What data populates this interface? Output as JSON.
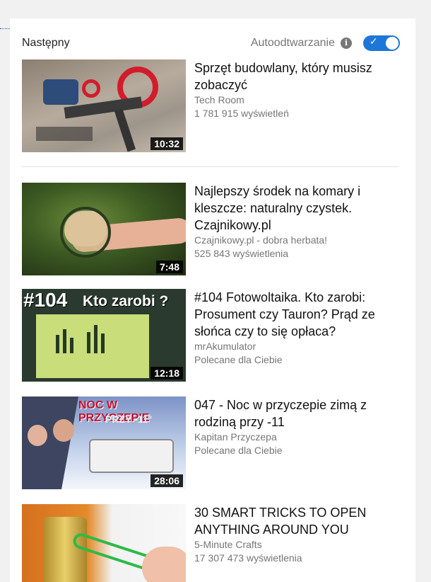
{
  "header": {
    "up_next": "Następny",
    "autoplay_label": "Autoodtwarzanie",
    "autoplay_info_icon": "info-icon",
    "autoplay_on": true
  },
  "colors": {
    "accent": "#1e77d8",
    "text_primary": "#111111",
    "text_secondary": "#767676"
  },
  "videos": [
    {
      "title": "Sprzęt budowlany, który musisz zobaczyć",
      "channel": "Tech Room",
      "stat": "1 781 915 wyświetleń",
      "duration": "10:32"
    },
    {
      "title": "Najlepszy środek na komary i kleszcze: naturalny czystek. Czajnikowy.pl",
      "channel": "Czajnikowy.pl - dobra herbata!",
      "stat": "525 843 wyświetlenia",
      "duration": "7:48"
    },
    {
      "title": "#104 Fotowoltaika. Kto zarobi: Prosument czy Tauron? Prąd ze słońca czy to się opłaca?",
      "channel": "mrAkumulator",
      "stat": "Polecane dla Ciebie",
      "duration": "12:18",
      "thumb_text": "#104",
      "thumb_text2": "Kto zarobi ?"
    },
    {
      "title": "047 - Noc w przyczepie zimą z rodziną przy -11",
      "channel": "Kapitan Przyczepa",
      "stat": "Polecane dla Ciebie",
      "duration": "28:06",
      "thumb_text": "NOC W PRZYCZEPIE",
      "thumb_text2": "PRZY -11°"
    },
    {
      "title": "30 SMART TRICKS TO OPEN ANYTHING AROUND YOU",
      "channel": "5-Minute Crafts",
      "stat": "17 307 473 wyświetlenia",
      "duration": ""
    }
  ]
}
